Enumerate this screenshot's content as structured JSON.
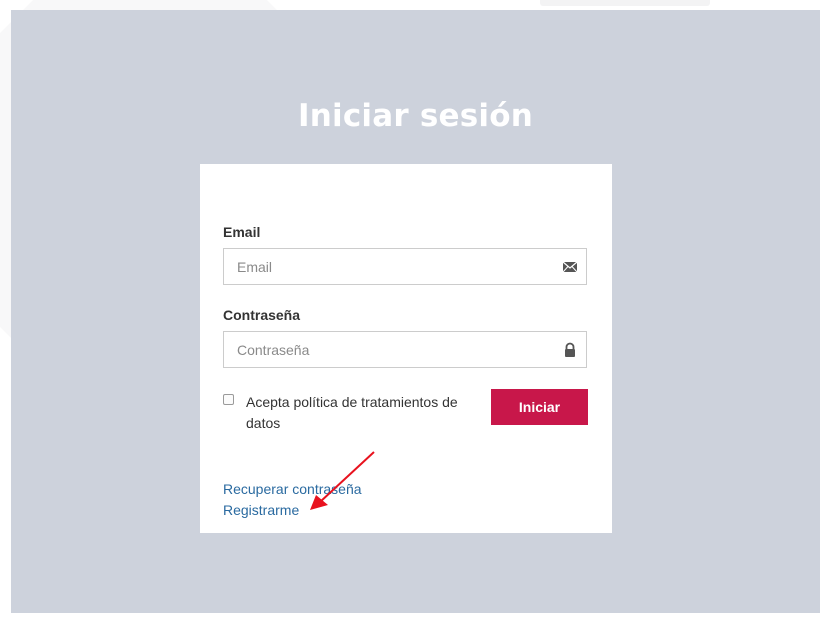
{
  "title": "Iniciar sesión",
  "form": {
    "email_label": "Email",
    "email_placeholder": "Email",
    "email_value": "",
    "password_label": "Contraseña",
    "password_placeholder": "Contraseña",
    "password_value": "",
    "checkbox_label": "Acepta política de tratamientos de datos",
    "checkbox_checked": false,
    "submit_label": "Iniciar"
  },
  "links": {
    "recover_password": "Recuperar contraseña",
    "register": "Registrarme"
  },
  "icons": {
    "email": "envelope-icon",
    "password": "lock-icon"
  },
  "colors": {
    "background": "#cdd2dc",
    "accent": "#c8174a",
    "link": "#2a6aa0",
    "annotation": "#e8121e"
  }
}
